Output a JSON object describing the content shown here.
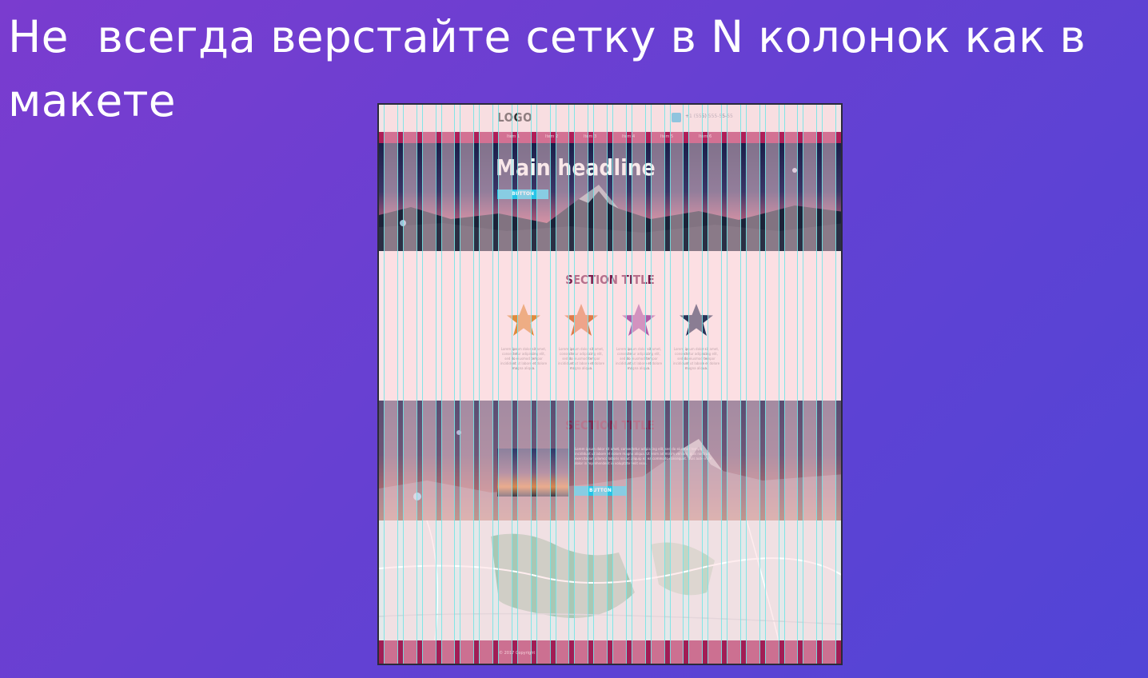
{
  "slide": {
    "title": "Не  всегда верстайте сетку в N колонок как в\nмакете"
  },
  "mockup": {
    "logo": "LOGO",
    "phone": "+1 (555) 555-55-55",
    "nav": [
      "Item 1",
      "Item 2",
      "Item 3",
      "Item 4",
      "Item 5",
      "Item 6"
    ],
    "hero": {
      "headline": "Main headline",
      "button": "BUTTON"
    },
    "section1": {
      "title": "SECTION TITLE",
      "features": [
        {
          "text": "Lorem ipsum dolor sit amet, consectetur adipiscing elit, sed do eiusmod tempor incididunt ut labore et dolore magna aliqua."
        },
        {
          "text": "Lorem ipsum dolor sit amet, consectetur adipiscing elit, sed do eiusmod tempor incididunt ut labore et dolore magna aliqua."
        },
        {
          "text": "Lorem ipsum dolor sit amet, consectetur adipiscing elit, sed do eiusmod tempor incididunt ut labore et dolore magna aliqua."
        },
        {
          "text": "Lorem ipsum dolor sit amet, consectetur adipiscing elit, sed do eiusmod tempor incididunt ut labore et dolore magna aliqua."
        }
      ],
      "star_colors": [
        "#e08a3c",
        "#e07a48",
        "#b05aa8",
        "#2a3458"
      ]
    },
    "section2": {
      "title": "SECTION TITLE",
      "text": "Lorem ipsum dolor sit amet, consectetur adipiscing elit, sed do eiusmod tempor incididunt ut labore et dolore magna aliqua. Ut enim ad minim veniam, quis nostrud exercitation ullamco laboris nisi ut aliquip ex ea commodo consequat. Duis aute irure dolor in reprehenderit in voluptate velit esse.",
      "button": "BUTTON"
    },
    "footer": {
      "copyright": "© 2017 Copyright"
    }
  },
  "colors": {
    "grid_column": "#ffd6dc",
    "grid_line": "#6fe6e6",
    "accent": "#27c3e8",
    "brand": "#b01e58"
  }
}
